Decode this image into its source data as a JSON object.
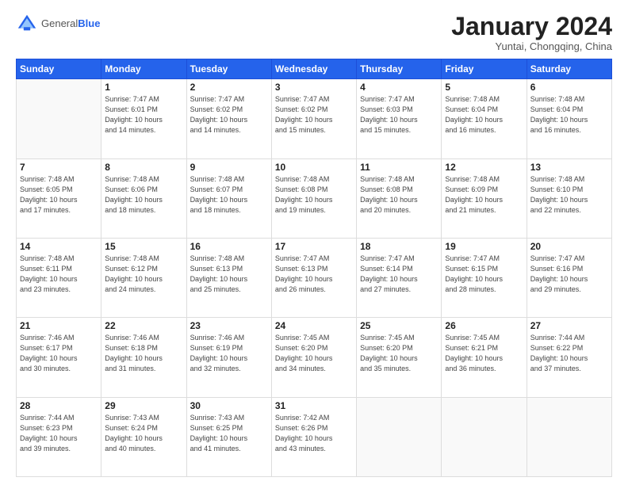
{
  "logo": {
    "general": "General",
    "blue": "Blue"
  },
  "header": {
    "month": "January 2024",
    "location": "Yuntai, Chongqing, China"
  },
  "weekdays": [
    "Sunday",
    "Monday",
    "Tuesday",
    "Wednesday",
    "Thursday",
    "Friday",
    "Saturday"
  ],
  "weeks": [
    [
      {
        "day": "",
        "empty": true
      },
      {
        "day": "1",
        "sunrise": "7:47 AM",
        "sunset": "6:01 PM",
        "daylight": "10 hours and 14 minutes."
      },
      {
        "day": "2",
        "sunrise": "7:47 AM",
        "sunset": "6:02 PM",
        "daylight": "10 hours and 14 minutes."
      },
      {
        "day": "3",
        "sunrise": "7:47 AM",
        "sunset": "6:02 PM",
        "daylight": "10 hours and 15 minutes."
      },
      {
        "day": "4",
        "sunrise": "7:47 AM",
        "sunset": "6:03 PM",
        "daylight": "10 hours and 15 minutes."
      },
      {
        "day": "5",
        "sunrise": "7:48 AM",
        "sunset": "6:04 PM",
        "daylight": "10 hours and 16 minutes."
      },
      {
        "day": "6",
        "sunrise": "7:48 AM",
        "sunset": "6:04 PM",
        "daylight": "10 hours and 16 minutes."
      }
    ],
    [
      {
        "day": "7",
        "sunrise": "7:48 AM",
        "sunset": "6:05 PM",
        "daylight": "10 hours and 17 minutes."
      },
      {
        "day": "8",
        "sunrise": "7:48 AM",
        "sunset": "6:06 PM",
        "daylight": "10 hours and 18 minutes."
      },
      {
        "day": "9",
        "sunrise": "7:48 AM",
        "sunset": "6:07 PM",
        "daylight": "10 hours and 18 minutes."
      },
      {
        "day": "10",
        "sunrise": "7:48 AM",
        "sunset": "6:08 PM",
        "daylight": "10 hours and 19 minutes."
      },
      {
        "day": "11",
        "sunrise": "7:48 AM",
        "sunset": "6:08 PM",
        "daylight": "10 hours and 20 minutes."
      },
      {
        "day": "12",
        "sunrise": "7:48 AM",
        "sunset": "6:09 PM",
        "daylight": "10 hours and 21 minutes."
      },
      {
        "day": "13",
        "sunrise": "7:48 AM",
        "sunset": "6:10 PM",
        "daylight": "10 hours and 22 minutes."
      }
    ],
    [
      {
        "day": "14",
        "sunrise": "7:48 AM",
        "sunset": "6:11 PM",
        "daylight": "10 hours and 23 minutes."
      },
      {
        "day": "15",
        "sunrise": "7:48 AM",
        "sunset": "6:12 PM",
        "daylight": "10 hours and 24 minutes."
      },
      {
        "day": "16",
        "sunrise": "7:48 AM",
        "sunset": "6:13 PM",
        "daylight": "10 hours and 25 minutes."
      },
      {
        "day": "17",
        "sunrise": "7:47 AM",
        "sunset": "6:13 PM",
        "daylight": "10 hours and 26 minutes."
      },
      {
        "day": "18",
        "sunrise": "7:47 AM",
        "sunset": "6:14 PM",
        "daylight": "10 hours and 27 minutes."
      },
      {
        "day": "19",
        "sunrise": "7:47 AM",
        "sunset": "6:15 PM",
        "daylight": "10 hours and 28 minutes."
      },
      {
        "day": "20",
        "sunrise": "7:47 AM",
        "sunset": "6:16 PM",
        "daylight": "10 hours and 29 minutes."
      }
    ],
    [
      {
        "day": "21",
        "sunrise": "7:46 AM",
        "sunset": "6:17 PM",
        "daylight": "10 hours and 30 minutes."
      },
      {
        "day": "22",
        "sunrise": "7:46 AM",
        "sunset": "6:18 PM",
        "daylight": "10 hours and 31 minutes."
      },
      {
        "day": "23",
        "sunrise": "7:46 AM",
        "sunset": "6:19 PM",
        "daylight": "10 hours and 32 minutes."
      },
      {
        "day": "24",
        "sunrise": "7:45 AM",
        "sunset": "6:20 PM",
        "daylight": "10 hours and 34 minutes."
      },
      {
        "day": "25",
        "sunrise": "7:45 AM",
        "sunset": "6:20 PM",
        "daylight": "10 hours and 35 minutes."
      },
      {
        "day": "26",
        "sunrise": "7:45 AM",
        "sunset": "6:21 PM",
        "daylight": "10 hours and 36 minutes."
      },
      {
        "day": "27",
        "sunrise": "7:44 AM",
        "sunset": "6:22 PM",
        "daylight": "10 hours and 37 minutes."
      }
    ],
    [
      {
        "day": "28",
        "sunrise": "7:44 AM",
        "sunset": "6:23 PM",
        "daylight": "10 hours and 39 minutes."
      },
      {
        "day": "29",
        "sunrise": "7:43 AM",
        "sunset": "6:24 PM",
        "daylight": "10 hours and 40 minutes."
      },
      {
        "day": "30",
        "sunrise": "7:43 AM",
        "sunset": "6:25 PM",
        "daylight": "10 hours and 41 minutes."
      },
      {
        "day": "31",
        "sunrise": "7:42 AM",
        "sunset": "6:26 PM",
        "daylight": "10 hours and 43 minutes."
      },
      {
        "day": "",
        "empty": true
      },
      {
        "day": "",
        "empty": true
      },
      {
        "day": "",
        "empty": true
      }
    ]
  ]
}
